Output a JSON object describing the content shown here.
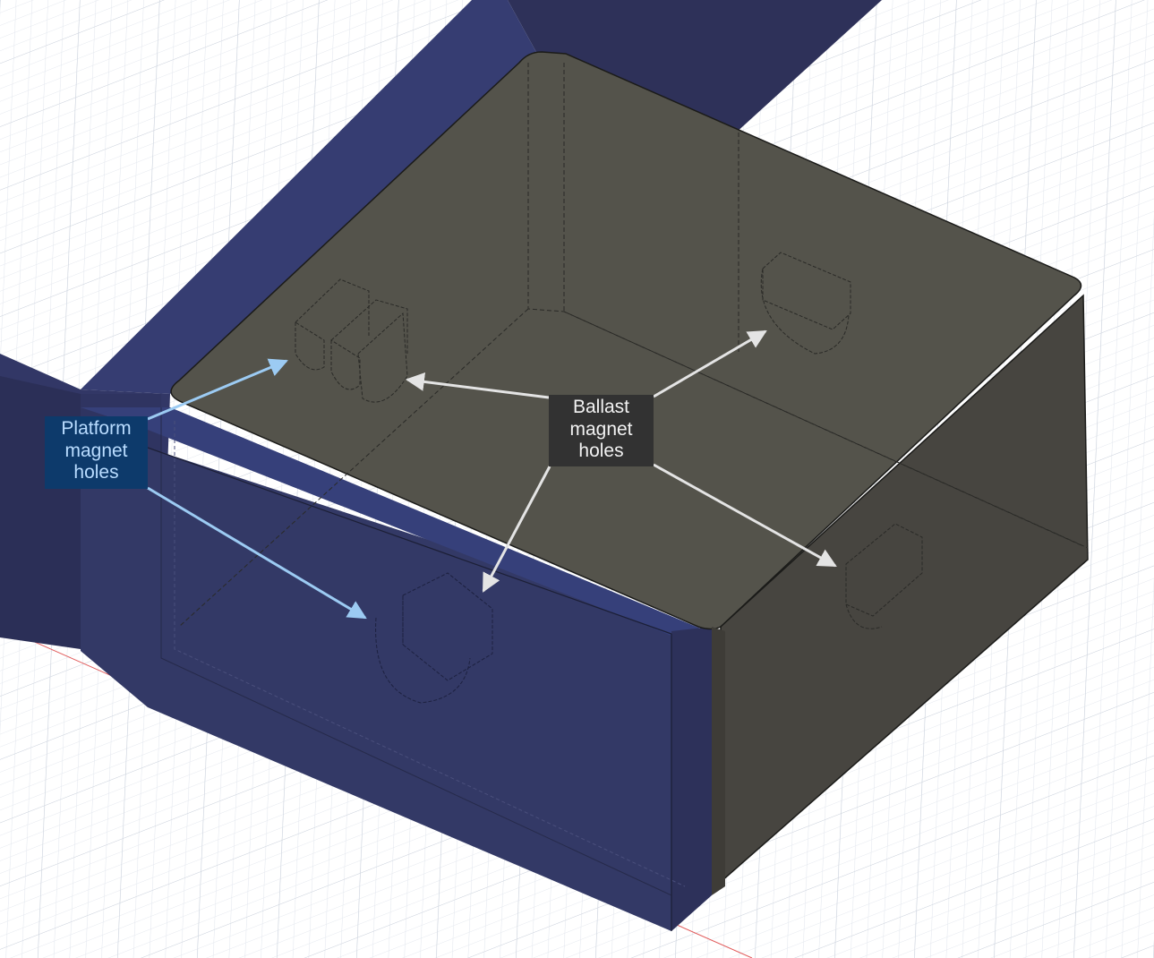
{
  "annotations": {
    "platform_magnet_holes": [
      "Platform",
      "magnet",
      "holes"
    ],
    "ballast_magnet_holes": [
      "Ballast",
      "magnet",
      "holes"
    ]
  },
  "colors": {
    "background": "#ffffff",
    "grid_line": "#d7dce4",
    "platform_face": "#333966",
    "platform_top": "#363d72",
    "box_top": "#54534b",
    "box_side": "#474540",
    "platform_callout_bg": "#0d3a6b",
    "platform_callout_text": "#b9dcff",
    "platform_arrow": "#9ccbf3",
    "ballast_callout_bg": "#323232",
    "ballast_callout_text": "#f2f2f2",
    "ballast_arrow": "#e4e4e4"
  }
}
